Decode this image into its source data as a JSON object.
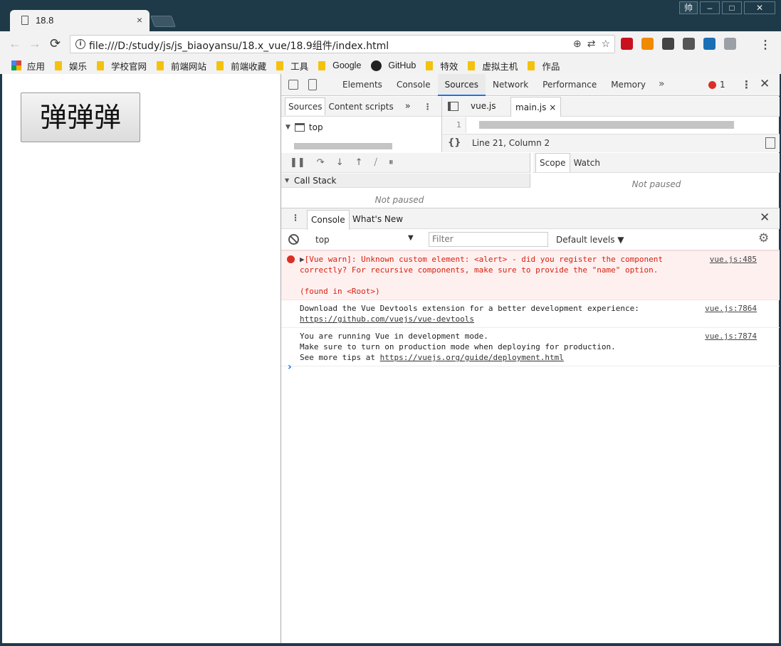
{
  "window": {
    "tab_title": "18.8",
    "tab_close": "×",
    "user_badge": "帅",
    "minimize": "–",
    "maximize": "□",
    "close": "✕"
  },
  "toolbar": {
    "back": "←",
    "forward": "→",
    "reload": "⟳",
    "url": "file:///D:/study/js/js_biaoyansu/18.x_vue/18.9组件/index.html",
    "menu": "⋮"
  },
  "extensions": [
    {
      "name": "ublock-icon",
      "color": "#c8101e"
    },
    {
      "name": "extension-orange-icon",
      "color": "#f08a00"
    },
    {
      "name": "extension-face-icon",
      "color": "#444444"
    },
    {
      "name": "extension-dark-icon",
      "color": "#555555"
    },
    {
      "name": "extension-blue-icon",
      "color": "#1a6fb5"
    },
    {
      "name": "extension-cloud-icon",
      "color": "#9aa0a6"
    }
  ],
  "bookmarks": [
    {
      "label": "应用",
      "icon": "apps"
    },
    {
      "label": "娱乐",
      "icon": "folder"
    },
    {
      "label": "学校官网",
      "icon": "folder"
    },
    {
      "label": "前端网站",
      "icon": "folder"
    },
    {
      "label": "前端收藏",
      "icon": "folder"
    },
    {
      "label": "工具",
      "icon": "folder"
    },
    {
      "label": "Google",
      "icon": "folder"
    },
    {
      "label": "GitHub",
      "icon": "github"
    },
    {
      "label": "特效",
      "icon": "folder"
    },
    {
      "label": "虚拟主机",
      "icon": "folder"
    },
    {
      "label": "作品",
      "icon": "folder"
    }
  ],
  "page": {
    "button_label": "弹弹弹"
  },
  "devtools": {
    "tabs": [
      "Elements",
      "Console",
      "Sources",
      "Network",
      "Performance",
      "Memory"
    ],
    "active_tab": "Sources",
    "more": "»",
    "error_count": "1",
    "nav_tabs": {
      "sources": "Sources",
      "content_scripts": "Content scripts",
      "more": "»"
    },
    "tree_top": "top",
    "editor_tabs": {
      "vue": "vue.js",
      "main": "main.js",
      "close": "×"
    },
    "line_number": "1",
    "cursor_position": "Line 21, Column 2",
    "call_stack": "Call Stack",
    "not_paused": "Not paused",
    "scope_tabs": {
      "scope": "Scope",
      "watch": "Watch"
    },
    "drawer_tabs": {
      "console": "Console",
      "whats_new": "What's New"
    },
    "console_context": "top",
    "filter_placeholder": "Filter",
    "levels": "Default levels ▼"
  },
  "console_messages": [
    {
      "type": "error",
      "text": "[Vue warn]: Unknown custom element: <alert> - did you register the component\ncorrectly? For recursive components, make sure to provide the \"name\" option.\n\n(found in <Root>)",
      "source": "vue.js:485"
    },
    {
      "type": "log",
      "text": "Download the Vue Devtools extension for a better development experience:",
      "link": "https://github.com/vuejs/vue-devtools",
      "source": "vue.js:7864"
    },
    {
      "type": "log",
      "text": "You are running Vue in development mode.\nMake sure to turn on production mode when deploying for production.\nSee more tips at ",
      "link": "https://vuejs.org/guide/deployment.html",
      "source": "vue.js:7874"
    }
  ],
  "prompt_symbol": "›"
}
